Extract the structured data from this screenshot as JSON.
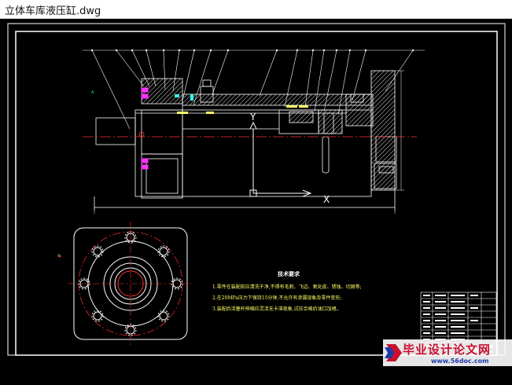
{
  "window": {
    "title": "立体车库液压缸.dwg"
  },
  "drawing": {
    "axis_y_label": "Y",
    "axis_x_label": "X",
    "tech_requirements": {
      "title": "技术要求",
      "lines": [
        "1.零件在装配前应清洗干净,不得有毛刺、飞边、氧化皮、锈蚀、切屑等;",
        "2.在20MPa压力下保持15分钟,不允许有渗漏现象及零件变形;",
        "3.装配后活塞杆伸缩应灵活无卡滞现象,试压合格后油口加堵。"
      ]
    }
  },
  "watermark": {
    "text": "毕业设计论文网",
    "url": "www.56doc.com"
  },
  "colors": {
    "background": "#000000",
    "line": "#ffffff",
    "yellow": "#ffff66",
    "magenta": "#ff33ff",
    "hatch": "#ffffff",
    "centerline": "#ff3030",
    "green": "#00ff66"
  }
}
